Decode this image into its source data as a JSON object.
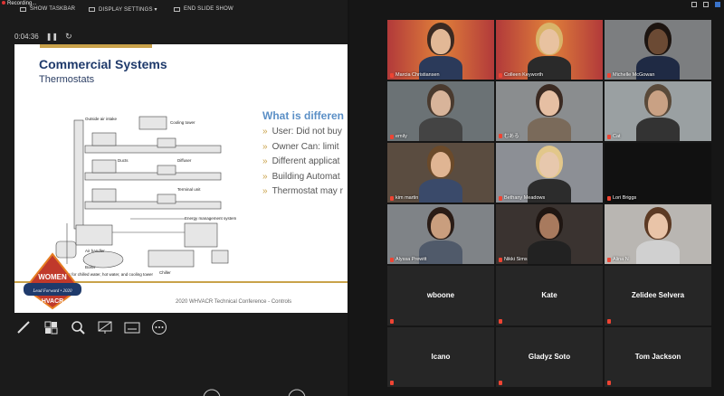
{
  "recording": "Recording...",
  "toolbar": {
    "show_taskbar": "SHOW TASKBAR",
    "display_settings": "DISPLAY SETTINGS ▾",
    "end_slide_show": "END SLIDE SHOW"
  },
  "timer": "0:04:36",
  "slide": {
    "title": "Commercial Systems",
    "subtitle": "Thermostats",
    "question": "What is differen",
    "bullets": [
      "User: Did not buy",
      "Owner Can: limit",
      "Different applicat",
      "Building Automat",
      "Thermostat may r"
    ],
    "footer": "2020 WHVACR Technical Conference - Controls",
    "diagram_labels": [
      "Outside air intake",
      "Cooling tower",
      "Ducts",
      "Diffuser",
      "Terminal unit",
      "Air handler",
      "Energy management system",
      "Pumps for chilled water, hot water, and cooling tower",
      "Boiler",
      "Chiller"
    ],
    "logo_text": "WOMEN",
    "logo_sub": "Lead Forward • 2020",
    "logo_brand": "HVACR"
  },
  "participants": [
    {
      "name": "Marcia Christiansen",
      "type": "video",
      "bg": "#c24a3a"
    },
    {
      "name": "Colleen Keyworth",
      "type": "video",
      "bg": "#c8503a"
    },
    {
      "name": "Michelle McGowan",
      "type": "video",
      "bg": "#7c7e80"
    },
    {
      "name": "emily",
      "type": "video",
      "bg": "#6b7275"
    },
    {
      "name": "むある",
      "type": "video",
      "bg": "#8a8d8f"
    },
    {
      "name": "Cat",
      "type": "video",
      "bg": "#9aa0a2"
    },
    {
      "name": "kim martin",
      "type": "video",
      "bg": "#5a4c40"
    },
    {
      "name": "Bethany Meadows",
      "type": "video",
      "bg": "#8c8f95"
    },
    {
      "name": "Lori Briggs",
      "type": "video",
      "bg": "#202020"
    },
    {
      "name": "Alyssa Prewitt",
      "type": "video",
      "bg": "#7f8387"
    },
    {
      "name": "Nikki Sims",
      "type": "video",
      "bg": "#3a3330"
    },
    {
      "name": "Alina N",
      "type": "video",
      "bg": "#b9b6b2"
    },
    {
      "name": "wboone",
      "type": "name"
    },
    {
      "name": "Kate",
      "type": "name"
    },
    {
      "name": "Zelidee Selvera",
      "type": "name"
    },
    {
      "name": "lcano",
      "type": "name"
    },
    {
      "name": "Gladyz Soto",
      "type": "name"
    },
    {
      "name": "Tom Jackson",
      "type": "name"
    }
  ]
}
